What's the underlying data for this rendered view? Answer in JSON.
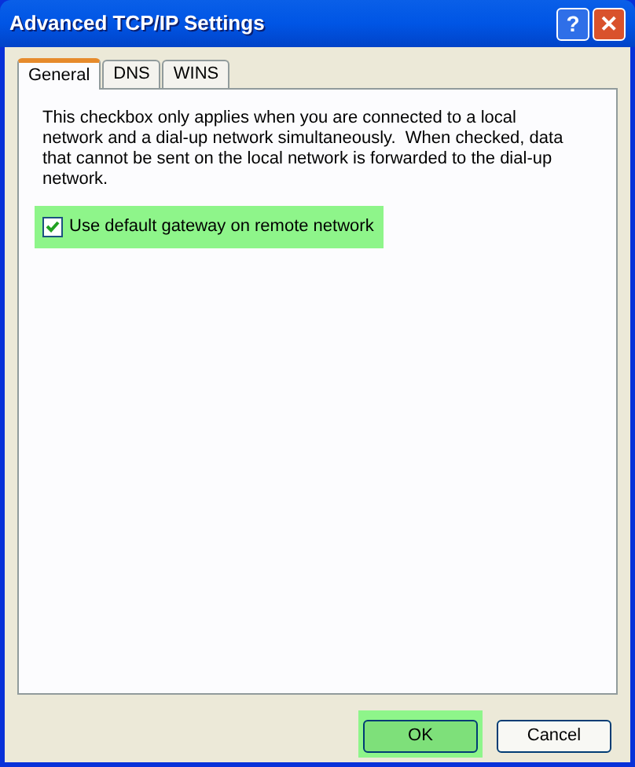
{
  "window": {
    "title": "Advanced TCP/IP Settings",
    "title_buttons": [
      {
        "kind": "help",
        "label": "?"
      },
      {
        "kind": "close",
        "label": "✕"
      }
    ]
  },
  "tabs": [
    {
      "label": "General",
      "selected": true
    },
    {
      "label": "DNS",
      "selected": false
    },
    {
      "label": "WINS",
      "selected": false
    }
  ],
  "description_lines": [
    "This checkbox only applies when you are connected to a local",
    "network and a dial-up network simultaneously.  When checked, data",
    "that cannot be sent on the local network is forwarded to the dial-up",
    "network."
  ],
  "checkbox": {
    "label": "Use default gateway on remote network",
    "checked": true,
    "highlighted": true
  },
  "buttons": [
    {
      "label": "OK",
      "highlighted": true
    },
    {
      "label": "Cancel",
      "highlighted": false
    }
  ]
}
